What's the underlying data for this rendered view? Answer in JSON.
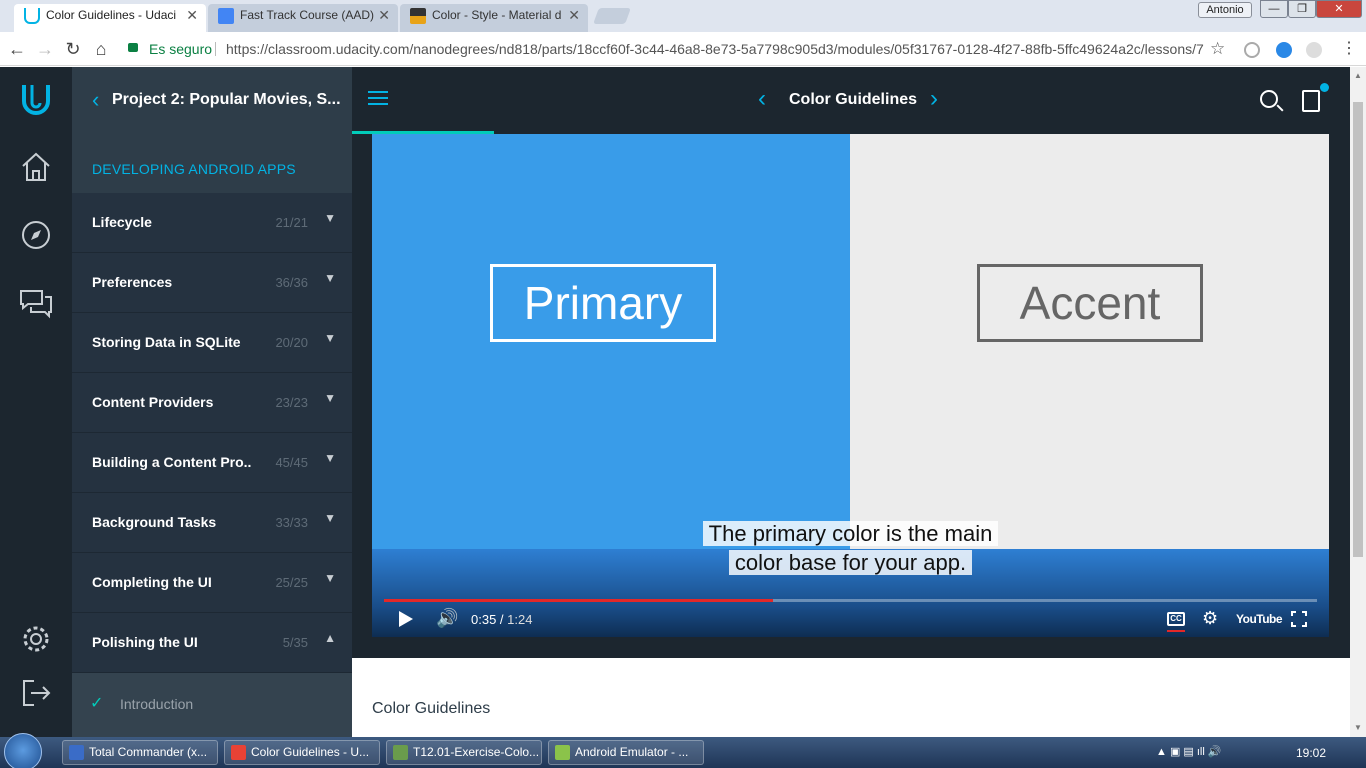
{
  "browser": {
    "tabs": [
      {
        "title": "Color Guidelines - Udaci",
        "active": true,
        "favicon_color": "#02b3e4"
      },
      {
        "title": "Fast Track Course (AAD)",
        "active": false,
        "favicon_color": "#4285f4"
      },
      {
        "title": "Color - Style - Material d",
        "active": false,
        "favicon_color": "#e8a317"
      }
    ],
    "profile": "Antonio",
    "window_controls": {
      "minimize": "—",
      "maximize": "❐",
      "close": "✕"
    },
    "nav": {
      "back": "←",
      "forward": "→",
      "reload": "↻",
      "home": "⌂"
    },
    "secure_label": "Es seguro",
    "url": "https://classroom.udacity.com/nanodegrees/nd818/parts/18ccf60f-3c44-46a8-8e73-5a7798c905d3/modules/05f31767-0128-4f27-88fb-5ffc49624a2c/lessons/7",
    "star": "☆"
  },
  "sidebar": {
    "back_title": "Project 2: Popular Movies, S...",
    "section": "DEVELOPING ANDROID APPS",
    "lessons": [
      {
        "name": "Lifecycle",
        "count": "21/21",
        "expanded": false
      },
      {
        "name": "Preferences",
        "count": "36/36",
        "expanded": false
      },
      {
        "name": "Storing Data in SQLite",
        "count": "20/20",
        "expanded": false
      },
      {
        "name": "Content Providers",
        "count": "23/23",
        "expanded": false
      },
      {
        "name": "Building a Content Pro...",
        "count": "45/45",
        "expanded": false
      },
      {
        "name": "Background Tasks",
        "count": "33/33",
        "expanded": false
      },
      {
        "name": "Completing the UI",
        "count": "25/25",
        "expanded": false
      },
      {
        "name": "Polishing the UI",
        "count": "5/35",
        "expanded": true
      }
    ],
    "current_concept": "Introduction",
    "caret_down": "⌄",
    "caret_up": "⌃"
  },
  "header": {
    "title": "Color Guidelines",
    "prev": "‹",
    "next": "›"
  },
  "video": {
    "primary_label": "Primary",
    "accent_label": "Accent",
    "caption_line1": "The primary color is the main",
    "caption_line2": "color base for your app.",
    "current_time": "0:35",
    "duration": "1:24",
    "progress_fraction": 0.417,
    "cc_label": "CC",
    "youtube_label": "YouTube",
    "colors": {
      "primary": "#399ce9",
      "accent_bg": "#ececec"
    }
  },
  "content": {
    "title": "Color Guidelines"
  },
  "taskbar": {
    "items": [
      {
        "label": "Total Commander (x...",
        "icon_color": "#3a6cc7"
      },
      {
        "label": "Color Guidelines - U...",
        "icon_color": "#e94235"
      },
      {
        "label": "T12.01-Exercise-Colo...",
        "icon_color": "#6a9c4c"
      },
      {
        "label": "Android Emulator - ...",
        "icon_color": "#8bc34a"
      }
    ],
    "clock": "19:02"
  },
  "icons": [
    "udacity-logo-icon",
    "home-icon",
    "compass-icon",
    "chat-icon",
    "settings-icon",
    "logout-icon",
    "search-icon",
    "notes-icon",
    "hamburger-icon"
  ]
}
